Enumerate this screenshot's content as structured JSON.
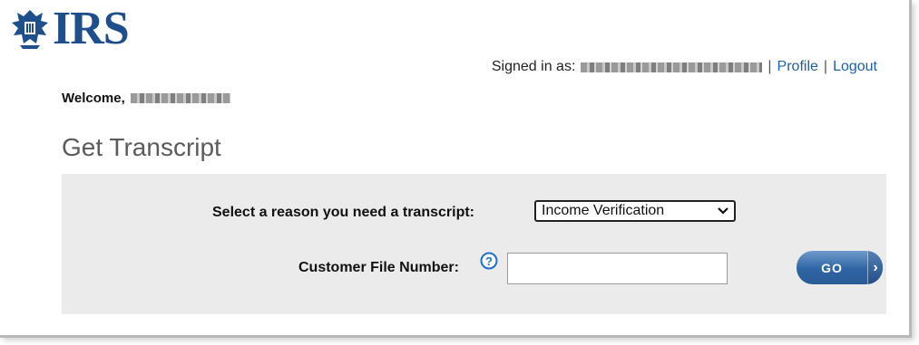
{
  "header": {
    "logo_text": "IRS",
    "signed_in_label": "Signed in as:",
    "separator": "|",
    "profile_link": "Profile",
    "logout_link": "Logout"
  },
  "welcome": {
    "label": "Welcome,"
  },
  "page": {
    "title": "Get Transcript"
  },
  "form": {
    "reason_label": "Select a reason you need a transcript:",
    "reason_selected": "Income Verification",
    "customer_file_label": "Customer File Number:",
    "customer_file_value": "",
    "go_label": "GO",
    "go_arrow": "›"
  },
  "colors": {
    "brand_blue": "#1f4e8c",
    "link_blue": "#1f5fa8",
    "panel_gray": "#ebebeb",
    "button_blue": "#2e64a4"
  },
  "icons": {
    "logo": "irs-eagle-icon",
    "help": "help-question-icon",
    "dropdown": "chevron-down-icon",
    "go": "chevron-right-icon"
  }
}
